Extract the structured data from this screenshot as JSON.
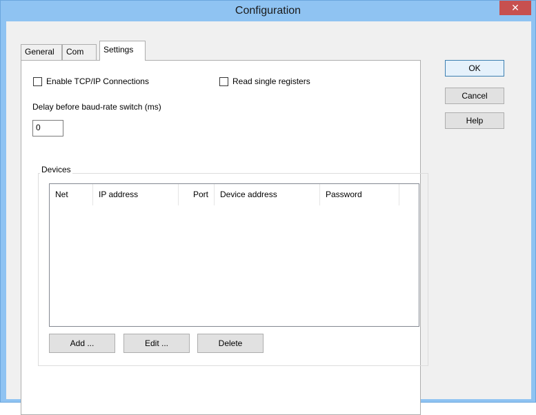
{
  "window": {
    "title": "Configuration",
    "close_glyph": "✕"
  },
  "tabs": [
    {
      "label": "General",
      "active": false
    },
    {
      "label": "Com",
      "active": false
    },
    {
      "label": "Settings",
      "active": true
    }
  ],
  "settings": {
    "enable_tcp_label": "Enable TCP/IP Connections",
    "enable_tcp_checked": false,
    "read_single_label": "Read single registers",
    "read_single_checked": false,
    "delay_label": "Delay before baud-rate switch (ms)",
    "delay_value": "0"
  },
  "devices": {
    "group_label": "Devices",
    "columns": [
      "Net",
      "IP address",
      "Port",
      "Device address",
      "Password"
    ],
    "rows": [],
    "add_label": "Add ...",
    "edit_label": "Edit ...",
    "delete_label": "Delete"
  },
  "buttons": {
    "ok_label": "OK",
    "cancel_label": "Cancel",
    "help_label": "Help"
  },
  "colors": {
    "titlebar": "#8fc3f2",
    "close": "#c7504f",
    "client": "#f0f0f0",
    "panel": "#ffffff"
  }
}
